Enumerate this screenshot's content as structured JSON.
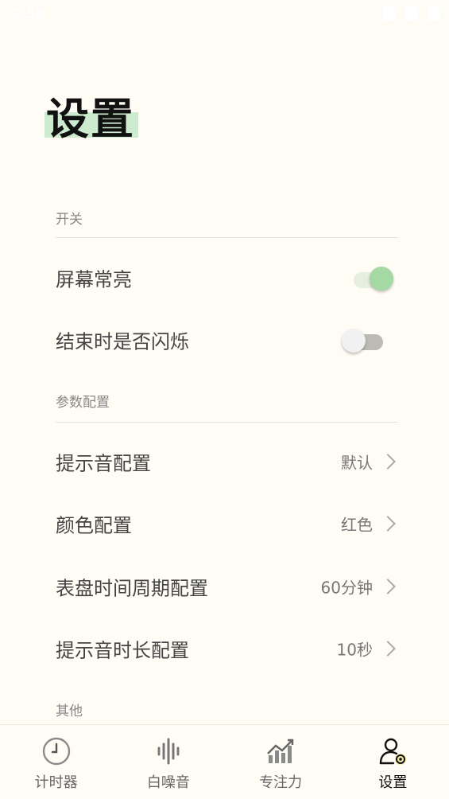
{
  "status_bar": {
    "time": "2:58"
  },
  "page": {
    "title": "设置"
  },
  "sections": {
    "switches": {
      "label": "开关"
    },
    "params": {
      "label": "参数配置"
    },
    "others": {
      "label": "其他"
    }
  },
  "settings": {
    "screen_on": {
      "label": "屏幕常亮",
      "enabled": true
    },
    "flash_on_end": {
      "label": "结束时是否闪烁",
      "enabled": false
    },
    "sound": {
      "label": "提示音配置",
      "value": "默认"
    },
    "color": {
      "label": "颜色配置",
      "value": "红色"
    },
    "dial_period": {
      "label": "表盘时间周期配置",
      "value": "60分钟"
    },
    "sound_duration": {
      "label": "提示音时长配置",
      "value": "10秒"
    }
  },
  "nav": {
    "items": [
      {
        "label": "计时器",
        "icon": "clock-icon",
        "active": false
      },
      {
        "label": "白噪音",
        "icon": "sound-wave-icon",
        "active": false
      },
      {
        "label": "专注力",
        "icon": "chart-icon",
        "active": false
      },
      {
        "label": "设置",
        "icon": "user-settings-icon",
        "active": true
      }
    ]
  },
  "colors": {
    "accent": "#a4d9a3",
    "highlight": "#cdeccf",
    "background": "#fefcf5"
  }
}
